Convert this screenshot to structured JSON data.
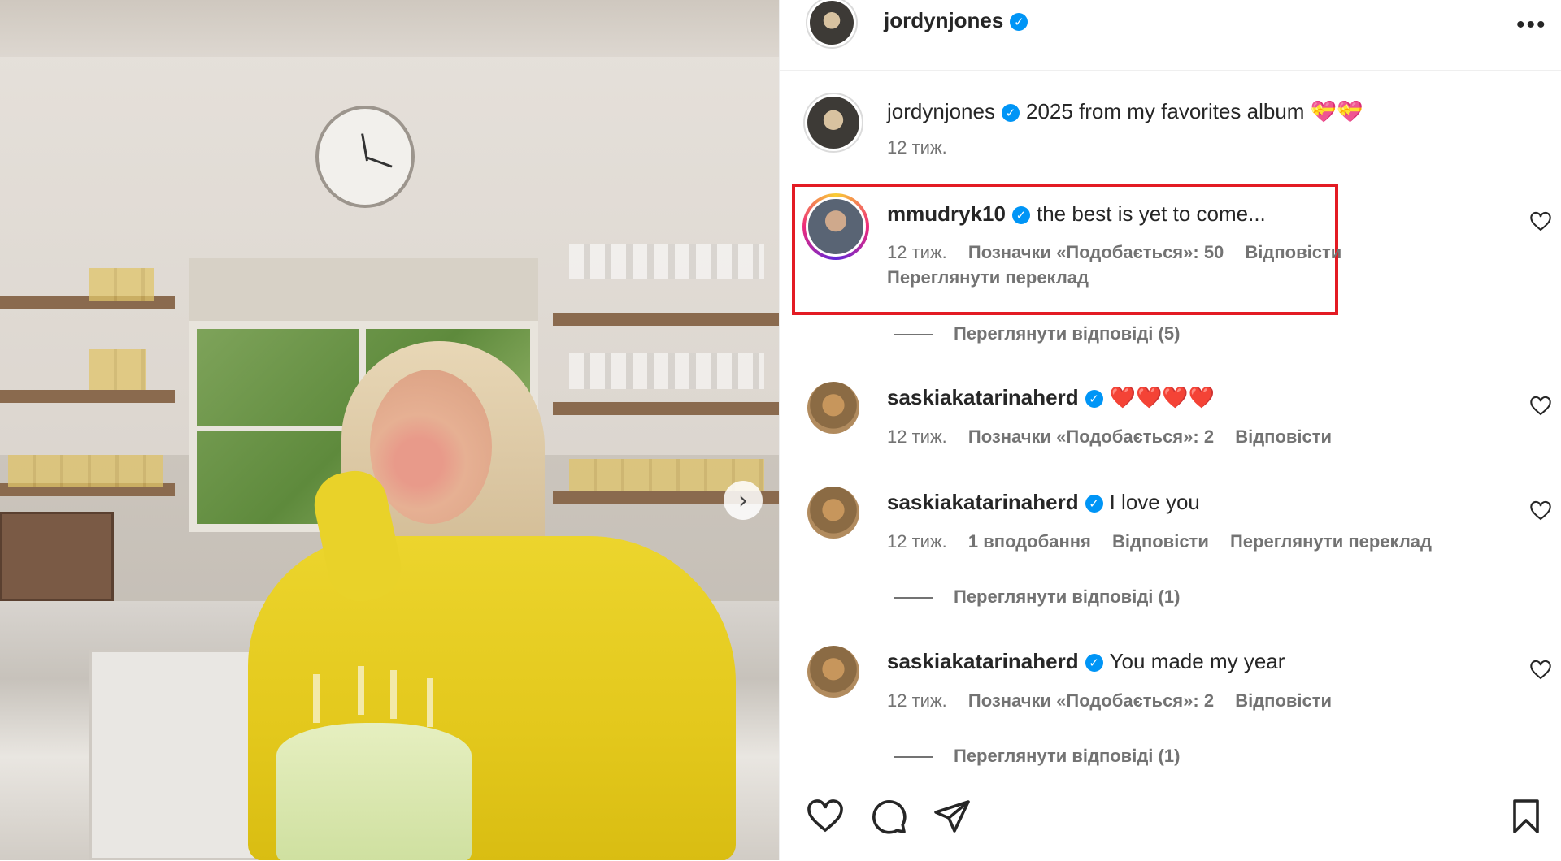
{
  "post": {
    "author": "jordynjones",
    "caption_user": "jordynjones",
    "caption_text": "2025 from my favorites album 💝💝",
    "caption_time": "12 тиж."
  },
  "comments": [
    {
      "user": "mmudryk10",
      "text": "the best is yet to come...",
      "time": "12 тиж.",
      "likes": "Позначки «Подобається»: 50",
      "reply": "Відповісти",
      "translate": "Переглянути переклад",
      "replies": "Переглянути відповіді (5)"
    },
    {
      "user": "saskiakatarinaherd",
      "text": "❤️❤️❤️❤️",
      "time": "12 тиж.",
      "likes": "Позначки «Подобається»: 2",
      "reply": "Відповісти"
    },
    {
      "user": "saskiakatarinaherd",
      "text": "I love you",
      "time": "12 тиж.",
      "likes": "1 вподобання",
      "reply": "Відповісти",
      "translate": "Переглянути переклад",
      "replies": "Переглянути відповіді (1)"
    },
    {
      "user": "saskiakatarinaherd",
      "text": "You made my year",
      "time": "12 тиж.",
      "likes": "Позначки «Подобається»: 2",
      "reply": "Відповісти",
      "replies": "Переглянути відповіді (1)"
    }
  ],
  "icons": {
    "verified": "verified-badge-icon",
    "more": "more-options-icon",
    "next": "chevron-right-icon",
    "like": "heart-icon",
    "comment": "comment-icon",
    "share": "share-icon",
    "save": "bookmark-icon"
  },
  "colors": {
    "highlight_border": "#e31b23",
    "verified": "#0095f6",
    "meta_text": "#737373"
  }
}
